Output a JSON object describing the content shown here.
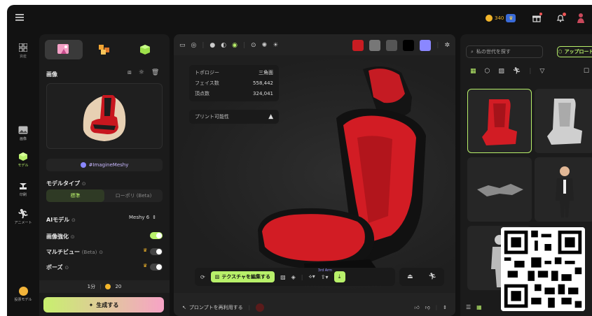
{
  "topbar": {
    "credits": "340"
  },
  "rail": {
    "image": "画像",
    "model": "モデル",
    "print": "印刷",
    "animate": "アニメート",
    "bottom": "投票モデル"
  },
  "left": {
    "section_image": "画像",
    "tag": "#ImagineMeshy",
    "model_type_label": "モデルタイプ",
    "type_standard": "標準",
    "type_lowpoly": "ローポリ (Beta)",
    "ai_model_label": "AIモデル",
    "ai_model_value": "Meshy 6",
    "enhance_label": "画像強化",
    "multiview_label": "マルチビュー",
    "multiview_beta": "(Beta)",
    "pose_label": "ポーズ",
    "cost_time": "1分",
    "cost_credits": "20",
    "generate": "生成する"
  },
  "center": {
    "info": [
      {
        "k": "トポロジー",
        "v": "三角面"
      },
      {
        "k": "フェイス数",
        "v": "558,442"
      },
      {
        "k": "頂点数",
        "v": "324,041"
      }
    ],
    "printable": "プリント可能性",
    "edit_texture": "テクスチャを編集する",
    "third_arm": "3rd Arm",
    "reuse_prompt": "プロンプトを再利用する"
  },
  "right": {
    "search_placeholder": "私の世代を探す",
    "upload": "アップロード"
  },
  "colors": {
    "accent": "#b8f06a",
    "generate_from": "#c8f06e",
    "generate_to": "#f7a3c6",
    "swatch_purple": "#8a87ff"
  }
}
